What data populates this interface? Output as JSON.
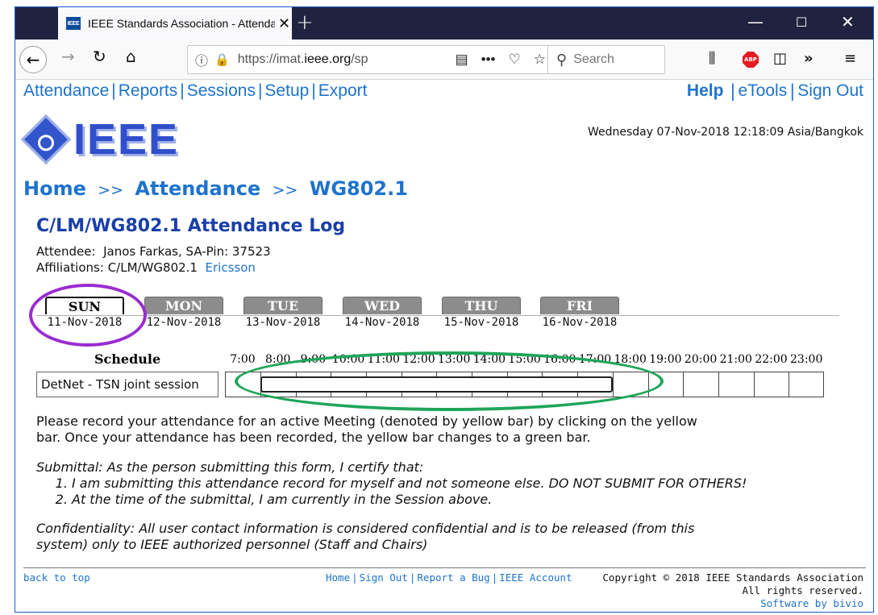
{
  "browser": {
    "tab_title": "IEEE Standards Association - Attendance",
    "favicon_text": "IEEE",
    "url_prefix": "https://imat.",
    "url_domain": "ieee.org",
    "url_suffix": "/sp",
    "search_placeholder": "Search",
    "abp_label": "ABP"
  },
  "menu": {
    "items": [
      "Attendance",
      "Reports",
      "Sessions",
      "Setup",
      "Export"
    ],
    "help": "Help",
    "etools": "eTools",
    "signout": "Sign Out"
  },
  "logo_text": "IEEE",
  "datetime": "Wednesday 07-Nov-2018 12:18:09 Asia/Bangkok",
  "breadcrumb": [
    "Home",
    "Attendance",
    "WG802.1"
  ],
  "breadcrumb_sep": ">>",
  "page_title": "C/LM/WG802.1 Attendance Log",
  "attendee": {
    "label": "Attendee:",
    "value": "Janos Farkas, SA-Pin: 37523",
    "affil_label": "Affiliations:",
    "affil_value": "C/LM/WG802.1",
    "company": "Ericsson"
  },
  "days": [
    {
      "day": "SUN",
      "date": "11-Nov-2018",
      "active": true
    },
    {
      "day": "MON",
      "date": "12-Nov-2018",
      "active": false
    },
    {
      "day": "TUE",
      "date": "13-Nov-2018",
      "active": false
    },
    {
      "day": "WED",
      "date": "14-Nov-2018",
      "active": false
    },
    {
      "day": "THU",
      "date": "15-Nov-2018",
      "active": false
    },
    {
      "day": "FRI",
      "date": "16-Nov-2018",
      "active": false
    }
  ],
  "schedule": {
    "heading": "Schedule",
    "hours": [
      "7:00",
      "8:00",
      "9:00",
      "10:00",
      "11:00",
      "12:00",
      "13:00",
      "14:00",
      "15:00",
      "16:00",
      "17:00",
      "18:00",
      "19:00",
      "20:00",
      "21:00",
      "22:00",
      "23:00"
    ],
    "session": "DetNet - TSN joint session",
    "meeting_start": "8:00",
    "meeting_end": "18:00"
  },
  "instructions": "Please record your attendance for an active Meeting (denoted by yellow bar) by clicking on the yellow bar. Once your attendance has been recorded, the yellow bar changes to a green bar.",
  "submittal": {
    "intro": "Submittal: As the person submitting this form, I certify that:",
    "items": [
      "I am submitting this attendance record for myself and not someone else. DO NOT SUBMIT FOR OTHERS!",
      "At the time of the submittal, I am currently in the Session above."
    ]
  },
  "confidentiality": "Confidentiality: All user contact information is considered confidential and is to be released (from this system) only to IEEE authorized personnel (Staff and Chairs)",
  "footer": {
    "back_to_top": "back to top",
    "links": [
      "Home",
      "Sign Out",
      "Report a Bug",
      "IEEE Account"
    ],
    "copyright": "Copyright © 2018 IEEE Standards Association",
    "rights": "All rights reserved.",
    "software": "Software by bivio"
  },
  "colors": {
    "link": "#1e73cc",
    "highlight_purple": "#9b2bd1",
    "highlight_green": "#1fa55a",
    "tab_inactive": "#8c8c8c"
  }
}
